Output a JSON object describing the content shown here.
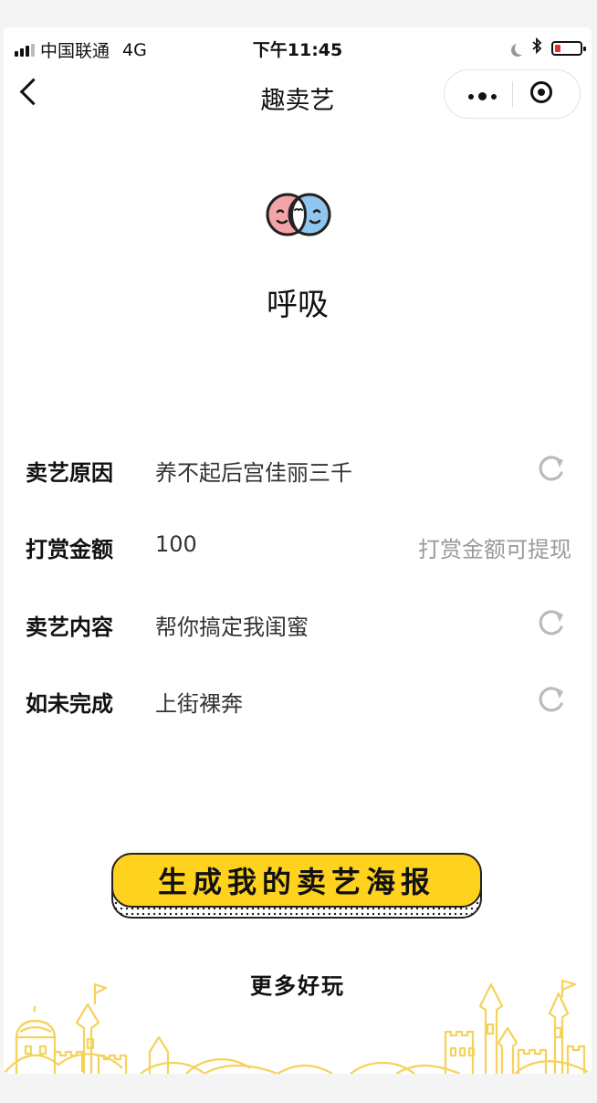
{
  "status_bar": {
    "carrier": "中国联通",
    "network": "4G",
    "time": "下午11:45"
  },
  "nav": {
    "title": "趣卖艺"
  },
  "profile": {
    "name": "呼吸"
  },
  "rows": [
    {
      "label": "卖艺原因",
      "value": "养不起后宫佳丽三千",
      "action": "refresh-icon"
    },
    {
      "label": "打赏金额",
      "value": "100",
      "hint": "打赏金额可提现"
    },
    {
      "label": "卖艺内容",
      "value": "帮你搞定我闺蜜",
      "action": "refresh-icon"
    },
    {
      "label": "如未完成",
      "value": "上街裸奔",
      "action": "refresh-icon"
    }
  ],
  "cta": {
    "label": "生成我的卖艺海报"
  },
  "footer": {
    "more_label": "更多好玩"
  },
  "colors": {
    "accent_yellow": "#ffd21e",
    "logo_pink": "#f4a3a8",
    "logo_blue": "#8fc6ee",
    "battery_red": "#e62e2e",
    "castle_yellow": "#f5d25a"
  }
}
